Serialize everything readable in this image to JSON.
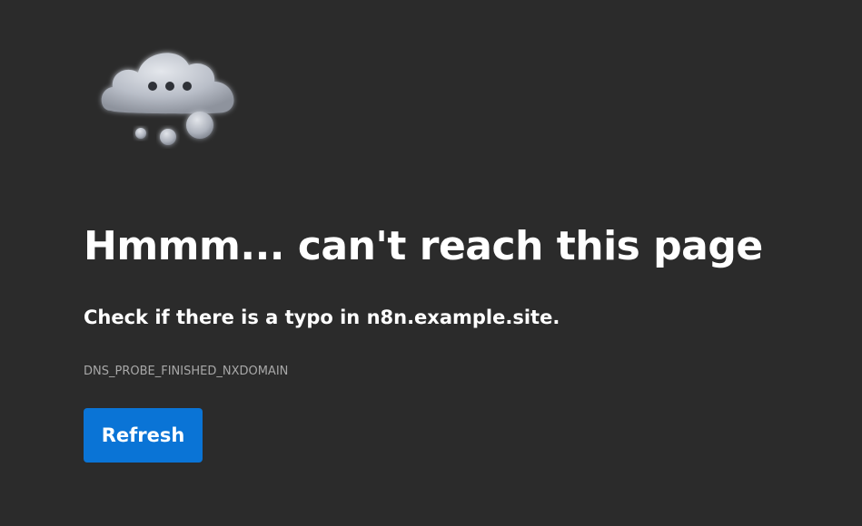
{
  "error_page": {
    "illustration_icon": "cloud-thinking-icon",
    "headline": "Hmmm... can't reach this page",
    "subtext": "Check if there is a typo in n8n.example.site.",
    "error_code": "DNS_PROBE_FINISHED_NXDOMAIN",
    "refresh_label": "Refresh"
  },
  "colors": {
    "background": "#2b2b2b",
    "text_primary": "#ffffff",
    "text_secondary": "#a8a8a8",
    "button_accent": "#0a74d6"
  }
}
